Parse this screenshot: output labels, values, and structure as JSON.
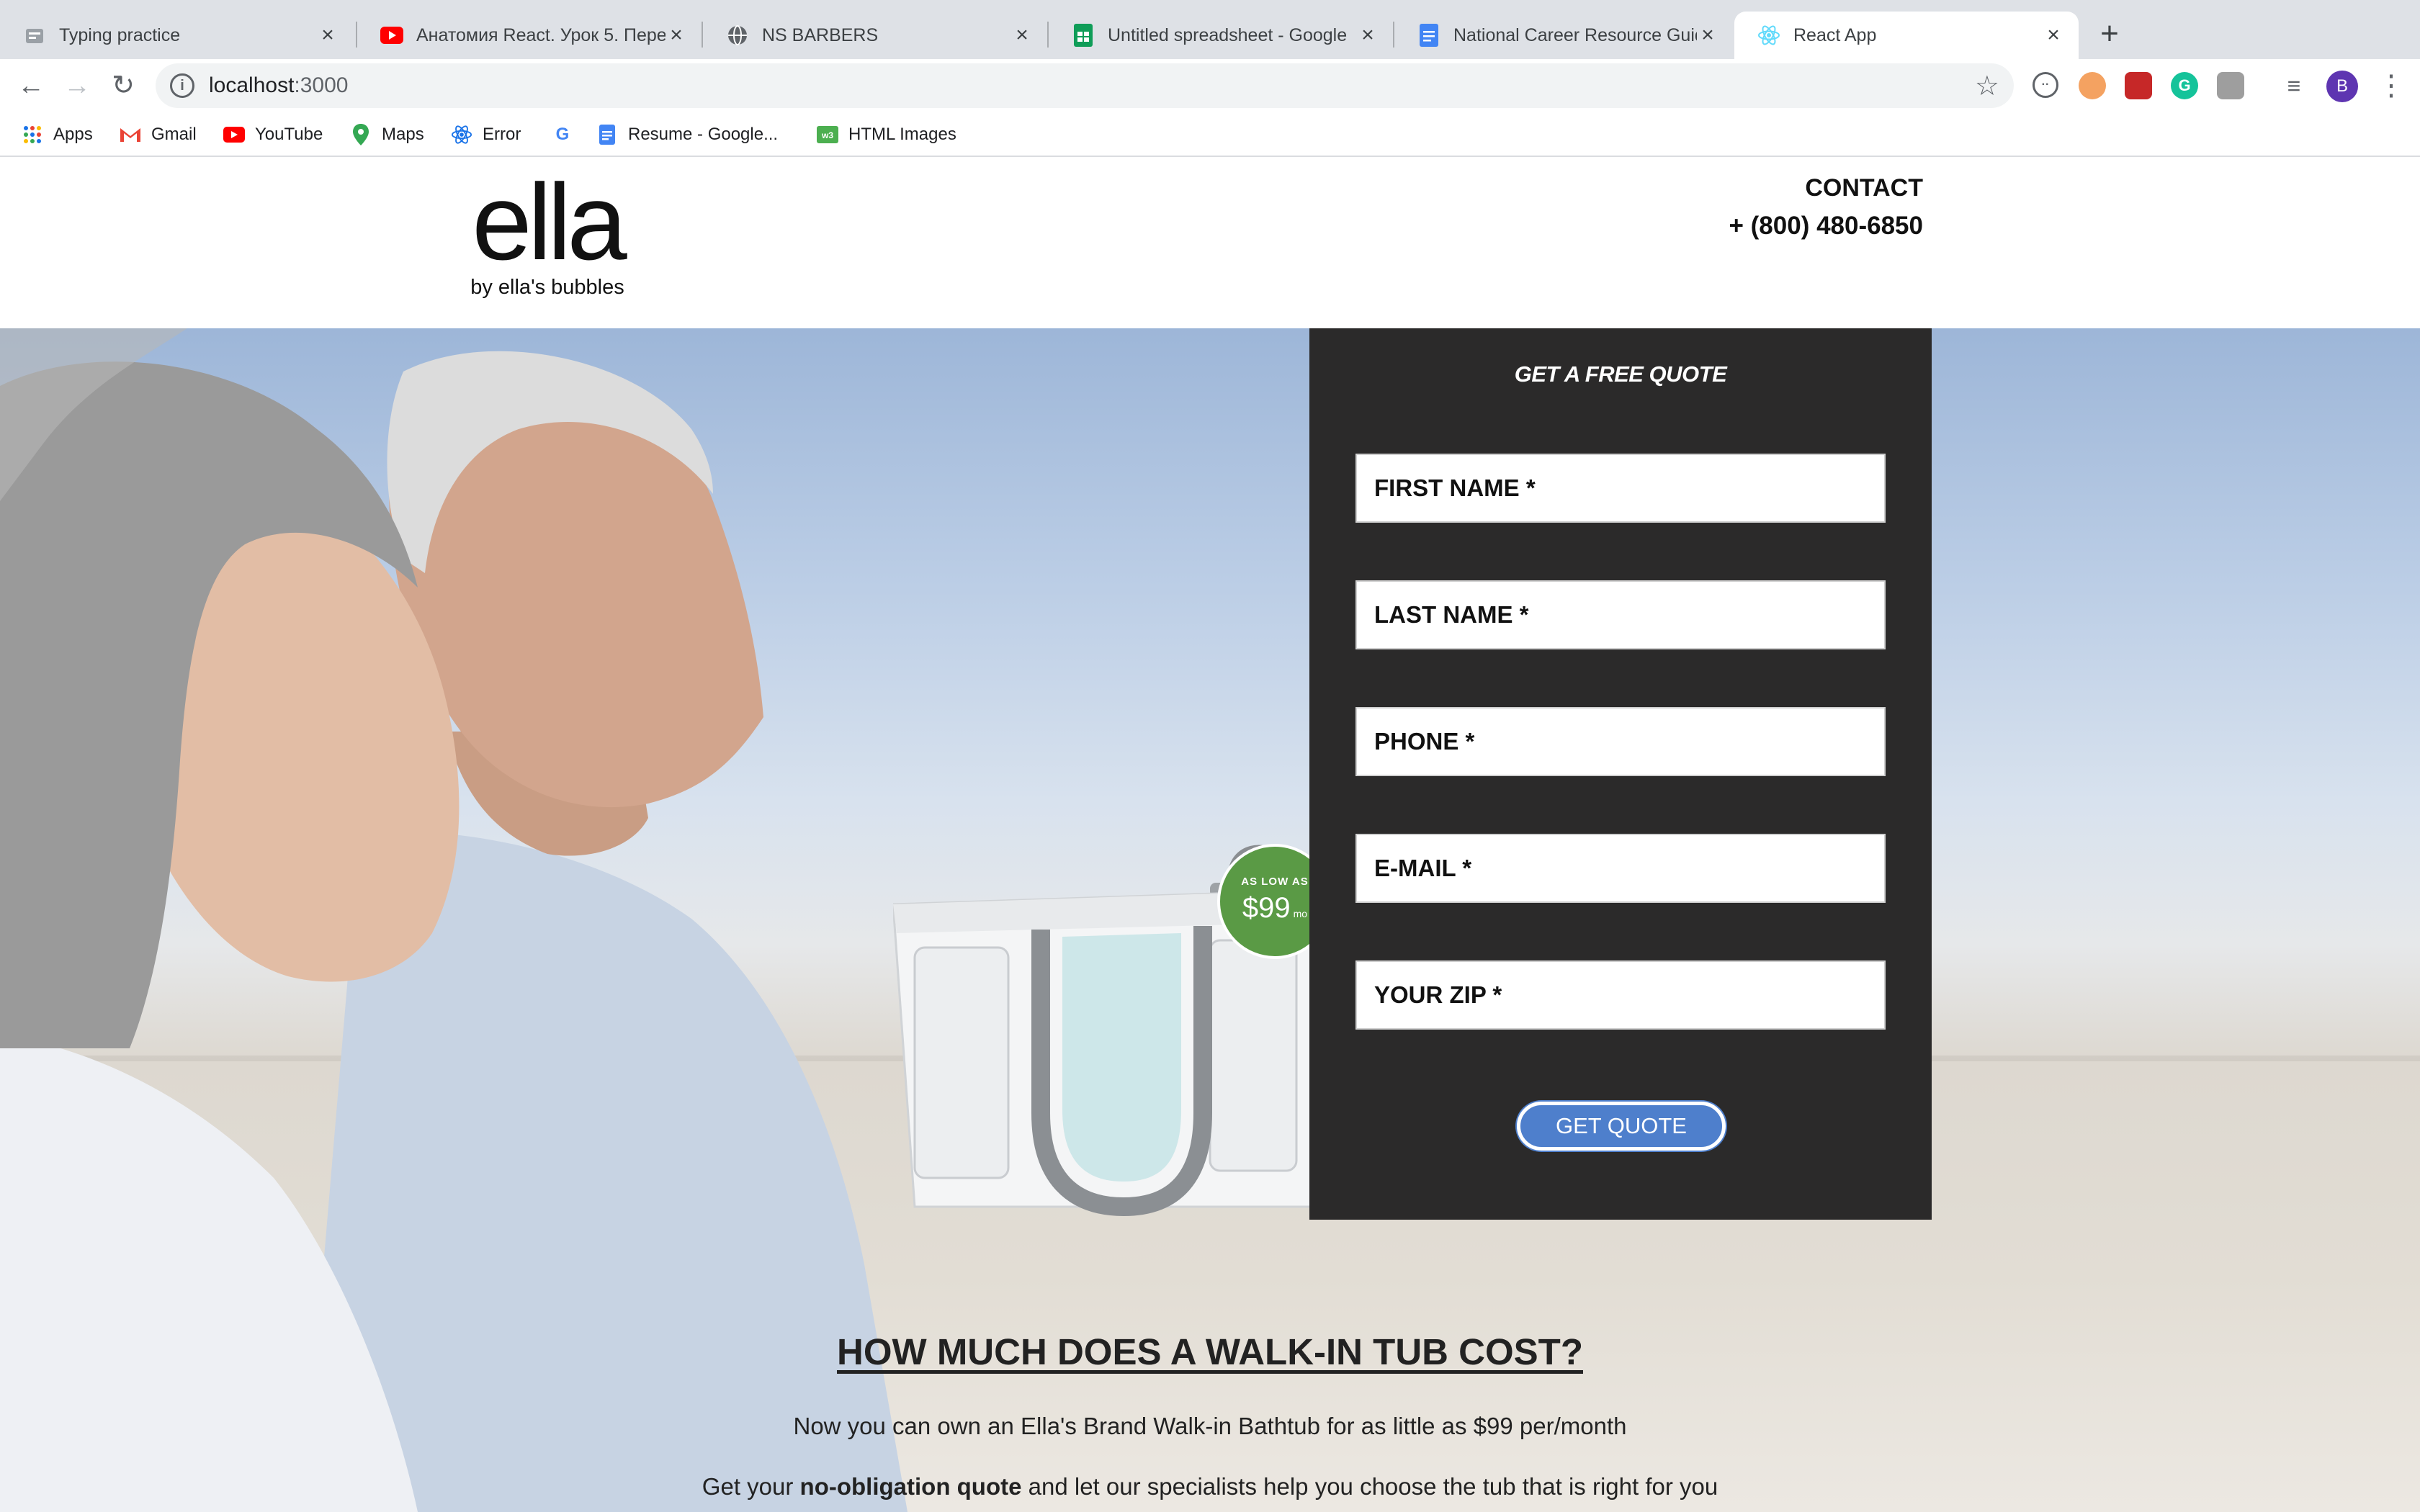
{
  "browser": {
    "tabs": [
      {
        "title": "Typing practice",
        "icon": "typing-icon",
        "active": false
      },
      {
        "title": "Анатомия React. Урок 5. Пере",
        "icon": "youtube-icon",
        "active": false
      },
      {
        "title": "NS BARBERS",
        "icon": "globe-icon",
        "active": false
      },
      {
        "title": "Untitled spreadsheet - Google",
        "icon": "sheets-icon",
        "active": false
      },
      {
        "title": "National Career Resource Guid",
        "icon": "docs-icon",
        "active": false
      },
      {
        "title": "React App",
        "icon": "react-icon",
        "active": true
      }
    ],
    "new_tab": "+",
    "address": {
      "host": "localhost",
      "port": ":3000"
    },
    "profile_initial": "B",
    "bookmarks": [
      {
        "label": "Apps",
        "icon": "apps-grid-icon"
      },
      {
        "label": "Gmail",
        "icon": "gmail-icon"
      },
      {
        "label": "YouTube",
        "icon": "youtube-icon"
      },
      {
        "label": "Maps",
        "icon": "maps-pin-icon"
      },
      {
        "label": "Error",
        "icon": "react-icon"
      },
      {
        "label": "",
        "icon": "google-g-icon"
      },
      {
        "label": "Resume - Google...",
        "icon": "docs-icon"
      },
      {
        "label": "HTML Images",
        "icon": "w3schools-icon"
      }
    ]
  },
  "header": {
    "logo_text": "ella",
    "logo_tagline": "by ella's bubbles",
    "contact_label": "CONTACT",
    "contact_phone": "+ (800) 480-6850"
  },
  "badge": {
    "line1": "AS LOW AS",
    "amount": "$99",
    "per": "mo",
    "color": "#5a9a45"
  },
  "quote_form": {
    "title": "GET A FREE QUOTE",
    "fields": [
      {
        "placeholder": "FIRST NAME *",
        "value": ""
      },
      {
        "placeholder": "LAST NAME *",
        "value": ""
      },
      {
        "placeholder": "PHONE *",
        "value": ""
      },
      {
        "placeholder": "E-MAIL *",
        "value": ""
      },
      {
        "placeholder": "YOUR ZIP *",
        "value": ""
      }
    ],
    "submit_label": "GET QUOTE",
    "submit_color": "#4e7fcc",
    "panel_color": "#2b2a2a"
  },
  "cost_section": {
    "heading": "HOW MUCH DOES A WALK-IN TUB COST?",
    "line1": "Now you can own an Ella's Brand Walk-in Bathtub for as little as $99 per/month",
    "line2_pre": "Get your ",
    "line2_bold": "no-obligation quote",
    "line2_post": " and let our specialists help you choose the tub that is right for you"
  }
}
